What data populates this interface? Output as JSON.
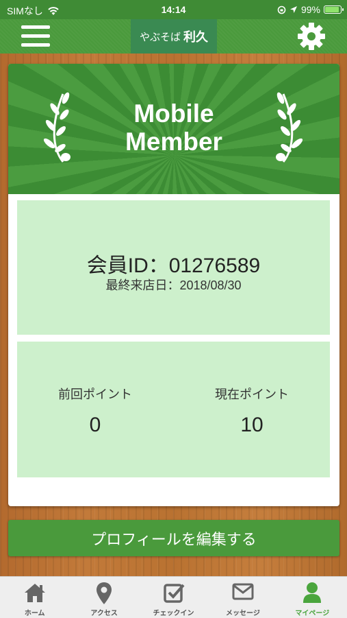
{
  "status": {
    "carrier": "SIMなし",
    "time": "14:14",
    "battery": "99%"
  },
  "header": {
    "logo_small": "やぶそば",
    "logo_big": "利久"
  },
  "banner": {
    "line1": "Mobile",
    "line2": "Member"
  },
  "member": {
    "id_text": "会員ID：01276589",
    "last_visit": "最終来店日：2018/08/30"
  },
  "points": {
    "previous_label": "前回ポイント",
    "previous_value": "0",
    "current_label": "現在ポイント",
    "current_value": "10"
  },
  "edit_button": "プロフィールを編集する",
  "tabs": [
    {
      "label": "ホーム",
      "icon": "home-icon"
    },
    {
      "label": "アクセス",
      "icon": "map-pin-icon"
    },
    {
      "label": "チェックイン",
      "icon": "checkin-icon"
    },
    {
      "label": "メッセージ",
      "icon": "mail-icon"
    },
    {
      "label": "マイページ",
      "icon": "user-icon",
      "active": true
    }
  ],
  "colors": {
    "primary": "#4a9a3c",
    "panel": "#cdf0cc",
    "active_tab": "#4aa53d"
  }
}
